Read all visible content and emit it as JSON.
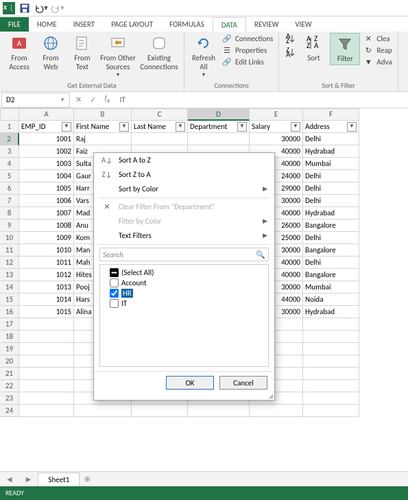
{
  "qat": {
    "app_initials": "X ⋮"
  },
  "tabs": {
    "file": "FILE",
    "home": "HOME",
    "insert": "INSERT",
    "page_layout": "PAGE LAYOUT",
    "formulas": "FORMULAS",
    "data": "DATA",
    "review": "REVIEW",
    "view": "VIEW"
  },
  "ribbon": {
    "from_access": "From Access",
    "from_web": "From Web",
    "from_text": "From Text",
    "from_other": "From Other Sources",
    "existing_conn": "Existing Connections",
    "group_ext": "Get External Data",
    "refresh": "Refresh All",
    "connections": "Connections",
    "properties": "Properties",
    "edit_links": "Edit Links",
    "group_conn": "Connections",
    "sort": "Sort",
    "filter": "Filter",
    "clear": "Clea",
    "reapply": "Reap",
    "advanced": "Adva",
    "group_sort": "Sort & Filter"
  },
  "namebox": "D2",
  "formula": "IT",
  "columns": [
    "A",
    "B",
    "C",
    "D",
    "E",
    "F"
  ],
  "headers": {
    "A": "EMP_ID",
    "B": "First Name",
    "C": "Last Name",
    "D": "Department",
    "E": "Salary",
    "F": "Address"
  },
  "rows": [
    {
      "A": "1001",
      "B": "Raj",
      "E": "30000",
      "F": "Delhi"
    },
    {
      "A": "1002",
      "B": "Faiz",
      "E": "40000",
      "F": "Hydrabad"
    },
    {
      "A": "1003",
      "B": "Sulta",
      "E": "40000",
      "F": "Mumbai"
    },
    {
      "A": "1004",
      "B": "Gaur",
      "E": "24000",
      "F": "Delhi"
    },
    {
      "A": "1005",
      "B": "Harr",
      "E": "29000",
      "F": "Delhi"
    },
    {
      "A": "1006",
      "B": "Vars",
      "E": "30000",
      "F": "Delhi"
    },
    {
      "A": "1007",
      "B": "Mad",
      "E": "40000",
      "F": "Hydrabad"
    },
    {
      "A": "1008",
      "B": "Anu",
      "E": "26000",
      "F": "Bangalore"
    },
    {
      "A": "1009",
      "B": "Kom",
      "E": "25000",
      "F": "Delhi"
    },
    {
      "A": "1010",
      "B": "Man",
      "E": "30000",
      "F": "Bangalore"
    },
    {
      "A": "1011",
      "B": "Mah",
      "E": "40000",
      "F": "Delhi"
    },
    {
      "A": "1012",
      "B": "Hites",
      "E": "40000",
      "F": "Bangalore"
    },
    {
      "A": "1013",
      "B": "Pooj",
      "E": "30000",
      "F": "Mumbai"
    },
    {
      "A": "1014",
      "B": "Hars",
      "E": "44000",
      "F": "Noida"
    },
    {
      "A": "1015",
      "B": "Alina",
      "E": "30000",
      "F": "Hydrabad"
    }
  ],
  "filter": {
    "sort_az": "Sort A to Z",
    "sort_za": "Sort Z to A",
    "sort_color": "Sort by Color",
    "clear": "Clear Filter From \"Department\"",
    "filter_color": "Filter by Color",
    "text_filters": "Text Filters",
    "search_ph": "Search",
    "items": {
      "all": "(Select All)",
      "account": "Account",
      "hr": "HR",
      "it": "IT"
    },
    "ok": "OK",
    "cancel": "Cancel"
  },
  "sheet": {
    "name": "Sheet1"
  },
  "status": "READY"
}
